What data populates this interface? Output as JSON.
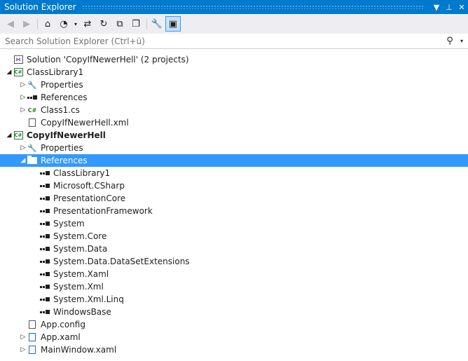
{
  "window": {
    "title": "Solution Explorer",
    "controls": {
      "dropdown": "▼",
      "pin": "⊥",
      "close": "✕"
    }
  },
  "toolbar": {
    "buttons": [
      {
        "icon": "back-icon",
        "glyph": "◀",
        "enabled": false
      },
      {
        "icon": "forward-icon",
        "glyph": "▶",
        "enabled": false
      },
      {
        "icon": "home-icon",
        "glyph": "⌂",
        "enabled": true
      },
      {
        "icon": "pending-changes-filter-icon",
        "glyph": "◔",
        "enabled": true
      },
      {
        "icon": "dropdown-arrow-icon",
        "glyph": "▾",
        "enabled": true
      },
      {
        "icon": "sync-icon",
        "glyph": "⇄",
        "enabled": true
      },
      {
        "icon": "refresh-icon",
        "glyph": "↻",
        "enabled": true
      },
      {
        "icon": "collapse-all-icon",
        "glyph": "⧉",
        "enabled": true
      },
      {
        "icon": "show-all-files-icon",
        "glyph": "❐",
        "enabled": true
      },
      {
        "icon": "properties-wrench-icon",
        "glyph": "🔧",
        "enabled": true
      },
      {
        "icon": "preview-selected-items-icon",
        "glyph": "▣",
        "enabled": true,
        "active": true
      }
    ]
  },
  "search": {
    "placeholder": "Search Solution Explorer (Ctrl+ü)",
    "icon": "search-icon",
    "value": ""
  },
  "tree": {
    "items": [
      {
        "label": "Solution 'CopyIfNewerHell' (2 projects)",
        "level": 0,
        "expander": "",
        "icon": "solution-icon",
        "bold": false
      },
      {
        "label": "ClassLibrary1",
        "level": 0,
        "expander": "◢",
        "icon": "csharp-project-icon",
        "bold": false
      },
      {
        "label": "Properties",
        "level": 1,
        "expander": "▷",
        "icon": "wrench-icon",
        "bold": false
      },
      {
        "label": "References",
        "level": 1,
        "expander": "▷",
        "icon": "reference-icon",
        "bold": false
      },
      {
        "label": "Class1.cs",
        "level": 1,
        "expander": "▷",
        "icon": "csharp-file-icon",
        "bold": false
      },
      {
        "label": "CopyIfNewerHell.xml",
        "level": 1,
        "expander": "",
        "icon": "xml-file-icon",
        "bold": false
      },
      {
        "label": "CopyIfNewerHell",
        "level": 0,
        "expander": "◢",
        "icon": "csharp-project-icon",
        "bold": true
      },
      {
        "label": "Properties",
        "level": 1,
        "expander": "▷",
        "icon": "wrench-icon",
        "bold": false
      },
      {
        "label": "References",
        "level": 1,
        "expander": "◢",
        "icon": "folder-open-icon",
        "bold": false,
        "selected": true
      },
      {
        "label": "ClassLibrary1",
        "level": 2,
        "expander": "",
        "icon": "reference-icon",
        "bold": false
      },
      {
        "label": "Microsoft.CSharp",
        "level": 2,
        "expander": "",
        "icon": "reference-icon",
        "bold": false
      },
      {
        "label": "PresentationCore",
        "level": 2,
        "expander": "",
        "icon": "reference-icon",
        "bold": false
      },
      {
        "label": "PresentationFramework",
        "level": 2,
        "expander": "",
        "icon": "reference-icon",
        "bold": false
      },
      {
        "label": "System",
        "level": 2,
        "expander": "",
        "icon": "reference-icon",
        "bold": false
      },
      {
        "label": "System.Core",
        "level": 2,
        "expander": "",
        "icon": "reference-icon",
        "bold": false
      },
      {
        "label": "System.Data",
        "level": 2,
        "expander": "",
        "icon": "reference-icon",
        "bold": false
      },
      {
        "label": "System.Data.DataSetExtensions",
        "level": 2,
        "expander": "",
        "icon": "reference-icon",
        "bold": false
      },
      {
        "label": "System.Xaml",
        "level": 2,
        "expander": "",
        "icon": "reference-icon",
        "bold": false
      },
      {
        "label": "System.Xml",
        "level": 2,
        "expander": "",
        "icon": "reference-icon",
        "bold": false
      },
      {
        "label": "System.Xml.Linq",
        "level": 2,
        "expander": "",
        "icon": "reference-icon",
        "bold": false
      },
      {
        "label": "WindowsBase",
        "level": 2,
        "expander": "",
        "icon": "reference-icon",
        "bold": false
      },
      {
        "label": "App.config",
        "level": 1,
        "expander": "",
        "icon": "config-file-icon",
        "bold": false
      },
      {
        "label": "App.xaml",
        "level": 1,
        "expander": "▷",
        "icon": "xaml-file-icon",
        "bold": false
      },
      {
        "label": "MainWindow.xaml",
        "level": 1,
        "expander": "▷",
        "icon": "xaml-file-icon",
        "bold": false
      }
    ]
  },
  "colors": {
    "titlebar": "#007acc",
    "toolbar": "#eeeef2",
    "selection": "#3399ff",
    "project_green": "#2e7d32"
  }
}
